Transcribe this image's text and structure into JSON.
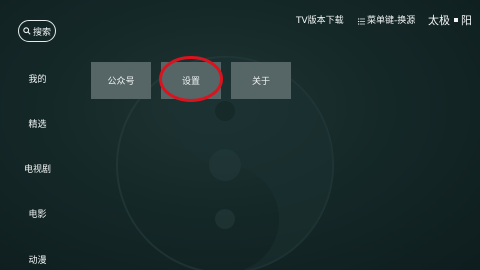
{
  "search": {
    "label": "搜索",
    "icon": "search-icon"
  },
  "sidebar": {
    "items": [
      {
        "label": "我的"
      },
      {
        "label": "精选"
      },
      {
        "label": "电视剧"
      },
      {
        "label": "电影"
      },
      {
        "label": "动漫"
      }
    ]
  },
  "header": {
    "tv_download": "TV版本下载",
    "menu_switch": "菜单键-换源",
    "menu_icon": "list-icon",
    "brand_left": "太极",
    "brand_right": "阳"
  },
  "tiles": [
    {
      "label": "公众号"
    },
    {
      "label": "设置"
    },
    {
      "label": "关于"
    }
  ],
  "colors": {
    "background": "#152828",
    "tile": "#566565",
    "highlight": "#d9141f"
  }
}
